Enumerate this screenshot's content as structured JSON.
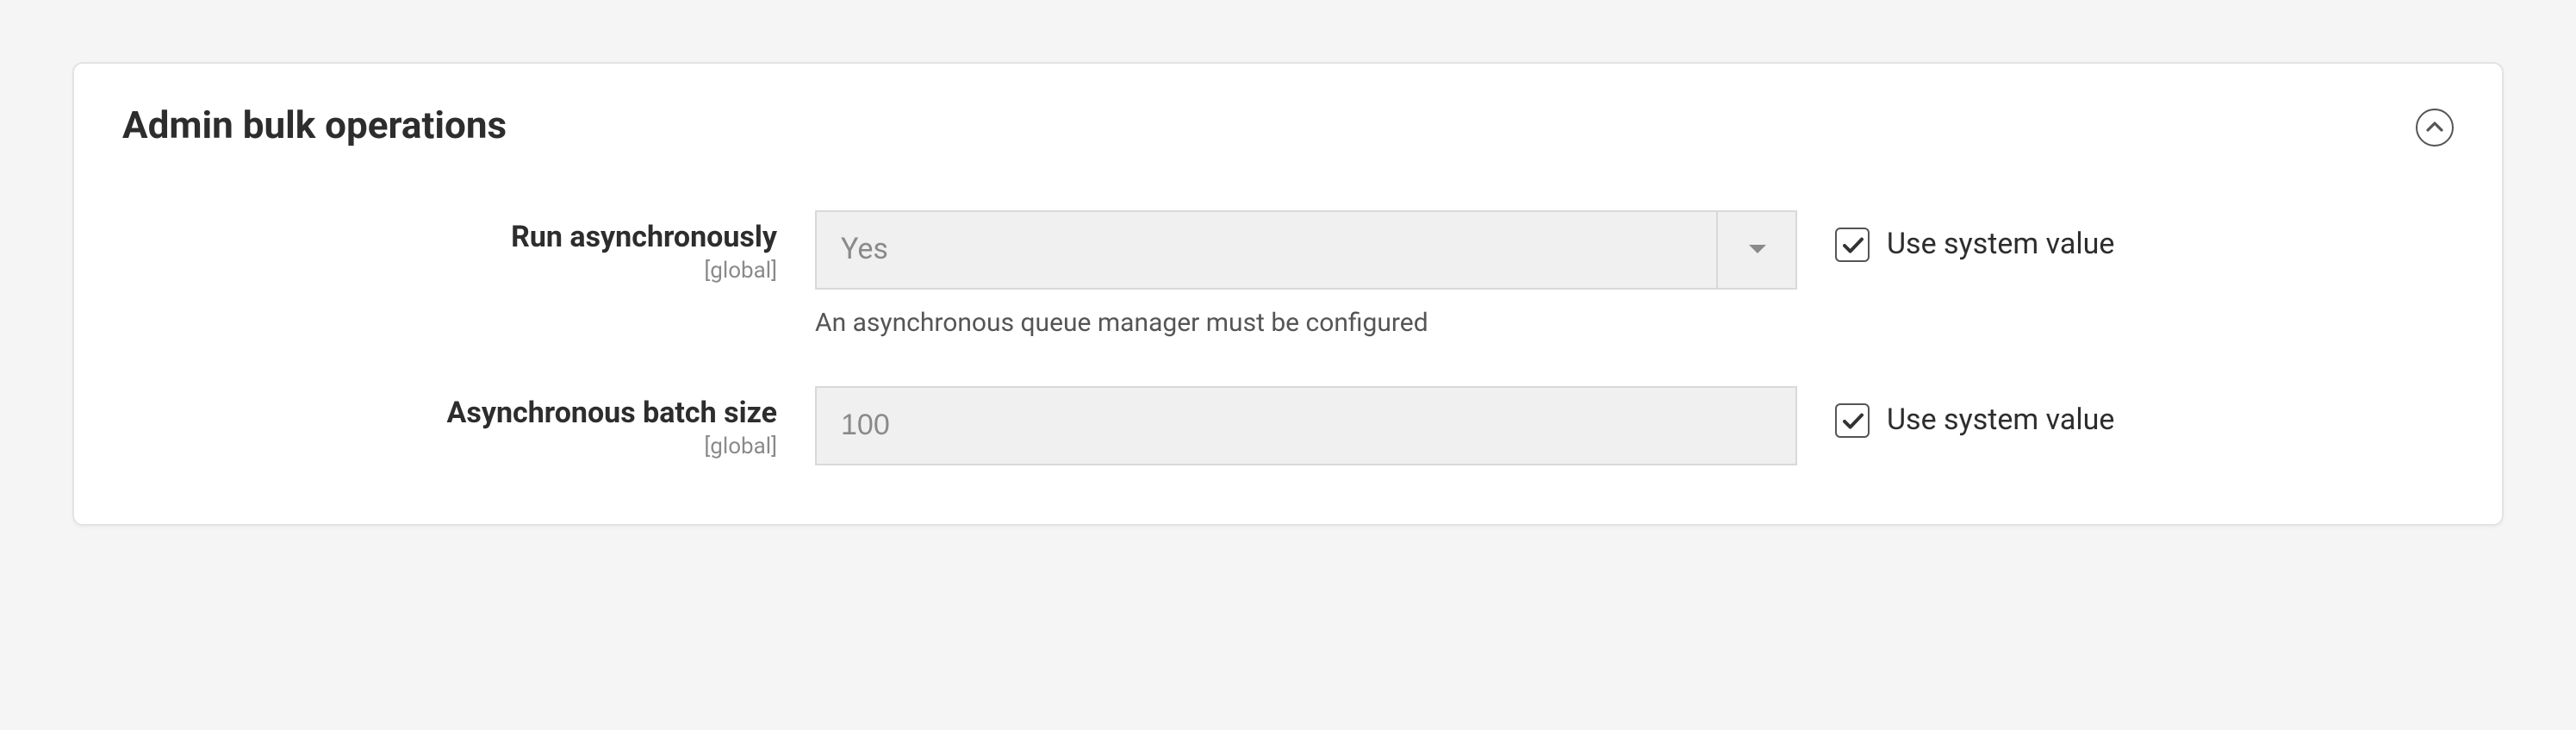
{
  "panel": {
    "title": "Admin bulk operations"
  },
  "fields": {
    "run_async": {
      "label": "Run asynchronously",
      "scope": "[global]",
      "value": "Yes",
      "note": "An asynchronous queue manager must be configured",
      "use_system_label": "Use system value",
      "use_system_checked": true
    },
    "batch_size": {
      "label": "Asynchronous batch size",
      "scope": "[global]",
      "value": "100",
      "use_system_label": "Use system value",
      "use_system_checked": true
    }
  }
}
